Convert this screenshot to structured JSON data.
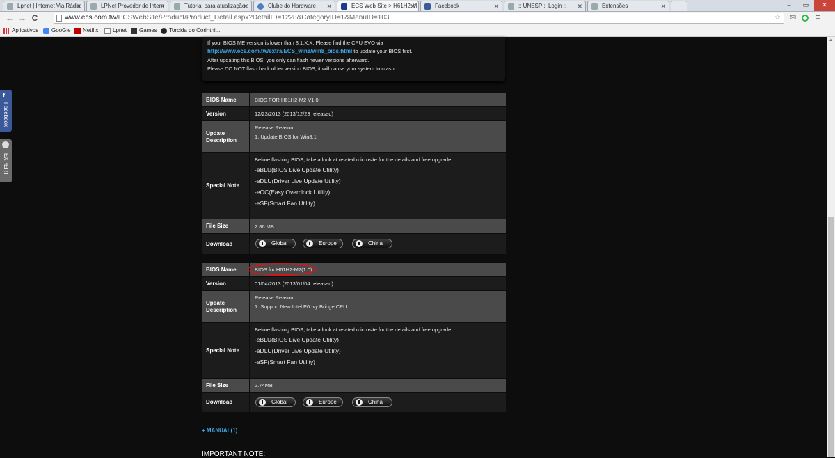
{
  "browser": {
    "tabs": [
      {
        "title": "Lpnet | Internet Via Rádio",
        "color": "#b8b8b8"
      },
      {
        "title": "LPNet Provedor de Intern",
        "color": "#b8b8b8"
      },
      {
        "title": "Tutorial para atualização",
        "color": "#b8b8b8"
      },
      {
        "title": "Clube do Hardware",
        "color": "#4a7fc1"
      },
      {
        "title": "ECS Web Site > H61H2-M",
        "color": "#1a3c8a"
      },
      {
        "title": "Facebook",
        "color": "#3b5998"
      },
      {
        "title": ":: UNESP :: Login ::",
        "color": "#b8b8b8"
      },
      {
        "title": "Extensões",
        "color": "#b8b8b8"
      }
    ],
    "window_buttons": {
      "minimize": "–",
      "maximize": "▭",
      "close": "✕"
    },
    "nav": {
      "back": "←",
      "forward": "→",
      "reload": "C"
    },
    "url_host": "www.ecs.com.tw",
    "url_path": "/ECSWebSite/Product/Product_Detail.aspx?DetailID=1228&CategoryID=1&MenuID=103",
    "bookmarks": [
      {
        "label": "Aplicativos",
        "icon": "apps-grid-icon"
      },
      {
        "label": "GooGle",
        "icon": "google-icon"
      },
      {
        "label": "Netflix",
        "icon": "netflix-icon"
      },
      {
        "label": "Lpnet",
        "icon": "page-icon"
      },
      {
        "label": "Games",
        "icon": "games-icon"
      },
      {
        "label": "Torcida do Corinthi...",
        "icon": "corinthians-icon"
      }
    ]
  },
  "side": {
    "facebook": "Facebook",
    "expert": "EXPERT"
  },
  "notice": {
    "line1": "If your BIOS ME version is lower than 8.1.X.X. Please find the CPU EVO via",
    "link": "http://www.ecs.com.tw/extra/ECS_win8/win8_bios.html",
    "link_suffix": " to update your BIOS first.",
    "line3": "After updating this BIOS, you only can flash newer versions afterward.",
    "line4": "Please DO NOT flash back older version BIOS, it will cause your system to crash."
  },
  "labels": {
    "bios_name": "BIOS Name",
    "version": "Version",
    "update_description": "Update Description",
    "special_note": "Special Note",
    "file_size": "File Size",
    "download": "Download"
  },
  "bios": [
    {
      "name": "BIOS FOR H61H2-M2 V1.0",
      "version": "12/23/2013 (2013/12/23 released)",
      "update_lines": [
        "Release Reason:",
        "1. Update BIOS for Win8.1"
      ],
      "note_intro": "Before flashing BIOS, take a look at related microsite for the details and free upgrade.",
      "note_items": [
        "-eBLU(BIOS Live Update Utility)",
        "-eDLU(Driver Live Update Utility)",
        "-eOC(Easy Overclock Utility)",
        "-eSF(Smart Fan Utility)"
      ],
      "file_size": "2.86 MB",
      "downloads": [
        "Global",
        "Europe",
        "China"
      ]
    },
    {
      "name": "BIOS for H61H2-M2(1.0)",
      "version": "01/04/2013 (2013/01/04 released)",
      "update_lines": [
        "Release Reason:",
        "1. Support New Intel P0 Ivy Bridge CPU"
      ],
      "note_intro": "Before flashing BIOS, take a look at related microsite for the details and free upgrade.",
      "note_items": [
        "-eBLU(BIOS Live Update Utility)",
        "-eDLU(Driver Live Update Utility)",
        "-eSF(Smart Fan Utility)"
      ],
      "file_size": "2.74MB",
      "downloads": [
        "Global",
        "Europe",
        "China"
      ]
    }
  ],
  "manual": "+ MANUAL(1)",
  "important": "IMPORTANT NOTE:",
  "colors": {
    "link": "#3ea8e8",
    "highlight_circle": "#d01818",
    "facebook": "#3b5998"
  }
}
